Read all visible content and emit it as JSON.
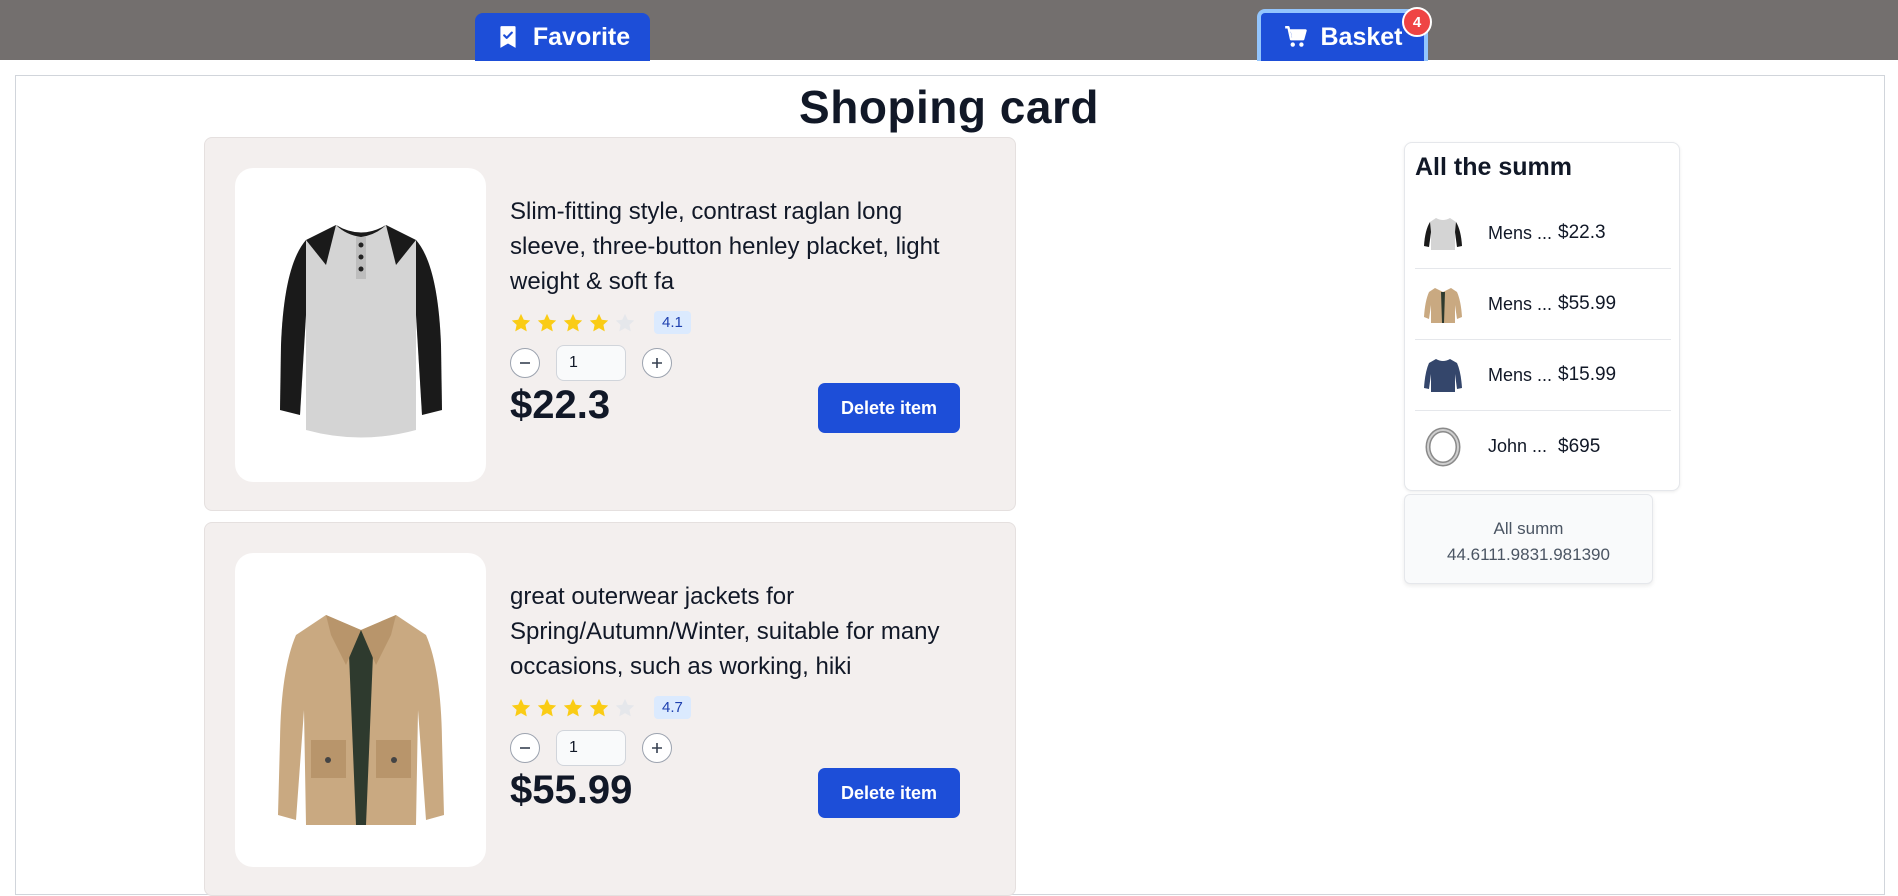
{
  "nav": {
    "favorite_label": "Favorite",
    "basket_label": "Basket",
    "basket_count": "4"
  },
  "page_title": "Shoping card",
  "cart_items": [
    {
      "description": "Slim-fitting style, contrast raglan long sleeve, three-button henley placket, light weight & soft fa",
      "rating": "4.1",
      "stars_filled": 4,
      "quantity": "1",
      "price": "$22.3",
      "delete_label": "Delete item"
    },
    {
      "description": "great outerwear jackets for Spring/Autumn/Winter, suitable for many occasions, such as working, hiki",
      "rating": "4.7",
      "stars_filled": 4,
      "quantity": "1",
      "price": "$55.99",
      "delete_label": "Delete item"
    }
  ],
  "summary": {
    "title": "All the summ",
    "items": [
      {
        "name": "Mens ...",
        "price": "$22.3",
        "icon": "henley-shirt-thumb"
      },
      {
        "name": "Mens ...",
        "price": "$55.99",
        "icon": "jacket-thumb"
      },
      {
        "name": "Mens ...",
        "price": "$15.99",
        "icon": "navy-shirt-thumb"
      },
      {
        "name": "John ...",
        "price": "$695",
        "icon": "bracelet-thumb"
      }
    ],
    "total_label": "All summ",
    "total_value": "44.6111.9831.981390"
  },
  "colors": {
    "topbar": "#736f6e",
    "primary": "#1d4ed8",
    "card_bg": "#f3efee",
    "badge": "#ef4444",
    "star": "#facc15"
  }
}
